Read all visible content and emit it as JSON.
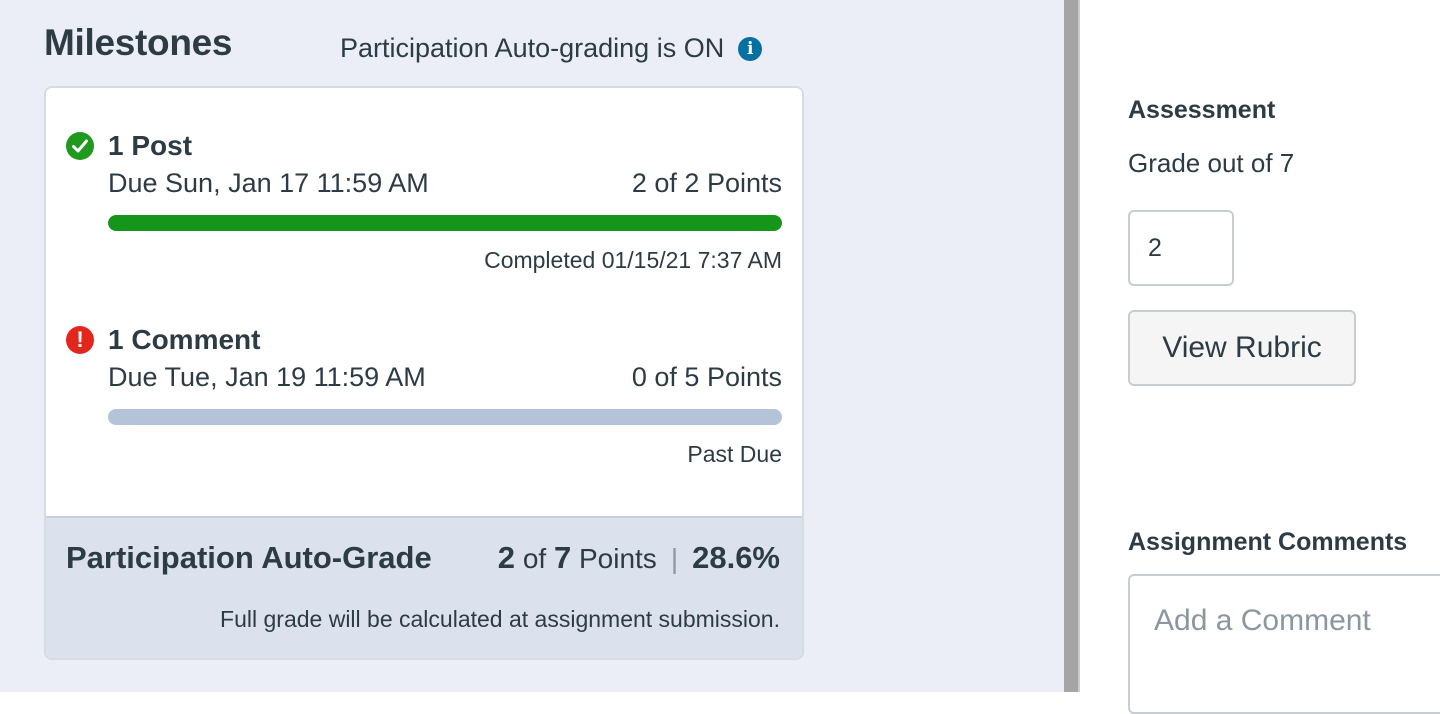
{
  "milestones": {
    "title": "Milestones",
    "autograde_note": "Participation Auto-grading is ON",
    "info_icon_glyph": "i",
    "items": [
      {
        "name": "1 Post",
        "status": "complete",
        "due": "Due Sun, Jan 17 11:59 AM",
        "points": "2 of 2 Points",
        "progress_fraction": 1.0,
        "footer": "Completed 01/15/21 7:37 AM"
      },
      {
        "name": "1 Comment",
        "status": "past-due",
        "due": "Due Tue, Jan 19 11:59 AM",
        "points": "0 of 5 Points",
        "progress_fraction": 0.0,
        "footer": "Past Due"
      }
    ],
    "summary": {
      "title": "Participation Auto-Grade",
      "earned": "2",
      "of_word": "of",
      "total": "7",
      "points_word": "Points",
      "separator": "|",
      "percent": "28.6%",
      "note": "Full grade will be calculated at assignment submission."
    }
  },
  "assessment": {
    "label": "Assessment",
    "grade_out_of": "Grade out of 7",
    "grade_value": "2",
    "view_rubric_label": "View Rubric"
  },
  "comments": {
    "label": "Assignment Comments",
    "placeholder": "Add a Comment"
  },
  "colors": {
    "complete_green": "#15951a",
    "error_red": "#e3261b",
    "info_blue": "#0770a3",
    "bar_track": "#b5c3d8"
  }
}
